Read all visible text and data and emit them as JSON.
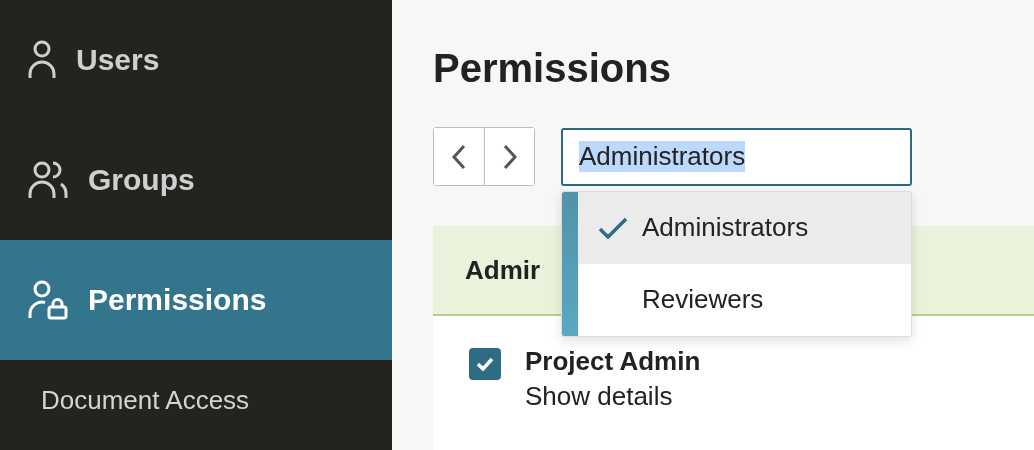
{
  "sidebar": {
    "items": [
      {
        "label": "Users",
        "kind": "user",
        "selected": false
      },
      {
        "label": "Groups",
        "kind": "group",
        "selected": false
      },
      {
        "label": "Permissions",
        "kind": "user-lock",
        "selected": true,
        "children": [
          {
            "label": "Document Access",
            "selected": false
          }
        ]
      }
    ]
  },
  "main": {
    "title": "Permissions",
    "group_field": {
      "value": "Administrators",
      "text_highlighted": true
    },
    "dropdown": {
      "options": [
        {
          "label": "Administrators",
          "selected": true
        },
        {
          "label": "Reviewers",
          "selected": false
        }
      ]
    },
    "card": {
      "title": "Admir",
      "items": [
        {
          "label": "Project Admin",
          "detail": "Show details",
          "checked": true
        }
      ]
    }
  }
}
